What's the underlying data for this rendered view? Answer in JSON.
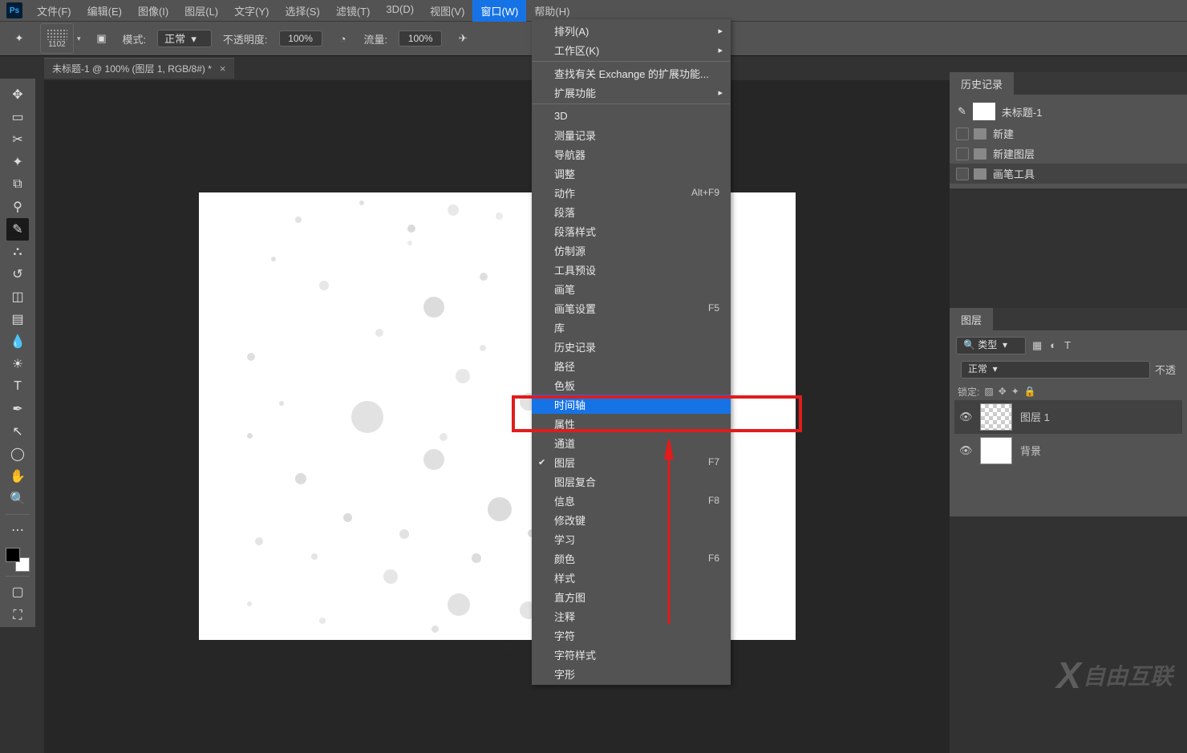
{
  "menubar": {
    "items": [
      "文件(F)",
      "编辑(E)",
      "图像(I)",
      "图层(L)",
      "文字(Y)",
      "选择(S)",
      "滤镜(T)",
      "3D(D)",
      "视图(V)",
      "窗口(W)",
      "帮助(H)"
    ],
    "open_index": 9
  },
  "optionsbar": {
    "brush_size": "1102",
    "mode_label": "模式:",
    "mode_value": "正常",
    "opacity_label": "不透明度:",
    "opacity_value": "100%",
    "flow_label": "流量:",
    "flow_value": "100%"
  },
  "document_tab": {
    "title": "未标题-1 @ 100% (图层 1, RGB/8#) *"
  },
  "window_menu": {
    "groups": [
      [
        {
          "label": "排列(A)",
          "arrow": true
        },
        {
          "label": "工作区(K)",
          "arrow": true
        }
      ],
      [
        {
          "label": "查找有关 Exchange 的扩展功能..."
        },
        {
          "label": "扩展功能",
          "arrow": true
        }
      ],
      [
        {
          "label": "3D"
        },
        {
          "label": "测量记录"
        },
        {
          "label": "导航器"
        },
        {
          "label": "调整"
        },
        {
          "label": "动作",
          "shortcut": "Alt+F9"
        },
        {
          "label": "段落"
        },
        {
          "label": "段落样式"
        },
        {
          "label": "仿制源"
        },
        {
          "label": "工具预设"
        },
        {
          "label": "画笔"
        },
        {
          "label": "画笔设置",
          "shortcut": "F5"
        },
        {
          "label": "库"
        },
        {
          "label": "历史记录"
        },
        {
          "label": "路径"
        },
        {
          "label": "色板"
        },
        {
          "label": "时间轴",
          "selected": true
        },
        {
          "label": "属性"
        },
        {
          "label": "通道"
        },
        {
          "label": "图层",
          "shortcut": "F7",
          "checked": true
        },
        {
          "label": "图层复合"
        },
        {
          "label": "信息",
          "shortcut": "F8"
        },
        {
          "label": "修改键"
        },
        {
          "label": "学习"
        },
        {
          "label": "颜色",
          "shortcut": "F6"
        },
        {
          "label": "样式"
        },
        {
          "label": "直方图"
        },
        {
          "label": "注释"
        },
        {
          "label": "字符"
        },
        {
          "label": "字符样式"
        },
        {
          "label": "字形"
        }
      ]
    ]
  },
  "history_panel": {
    "tab": "历史记录",
    "doc": "未标题-1",
    "steps": [
      "新建",
      "新建图层",
      "画笔工具"
    ]
  },
  "layers_panel": {
    "tab": "图层",
    "filter_label": "类型",
    "blend_mode": "正常",
    "opacity_label": "不透",
    "lock_label": "锁定:",
    "layers": [
      {
        "name": "图层 1",
        "checker": true,
        "selected": true
      },
      {
        "name": "背景",
        "checker": false
      }
    ]
  },
  "watermark": "自由互联",
  "tools": [
    "move",
    "marquee",
    "lasso",
    "wand",
    "crop",
    "eyedrop",
    "brush",
    "stamp",
    "history-brush",
    "eraser",
    "gradient",
    "blur",
    "dodge",
    "type",
    "pen",
    "path",
    "shape",
    "hand",
    "zoom"
  ],
  "active_tool_index": 6
}
